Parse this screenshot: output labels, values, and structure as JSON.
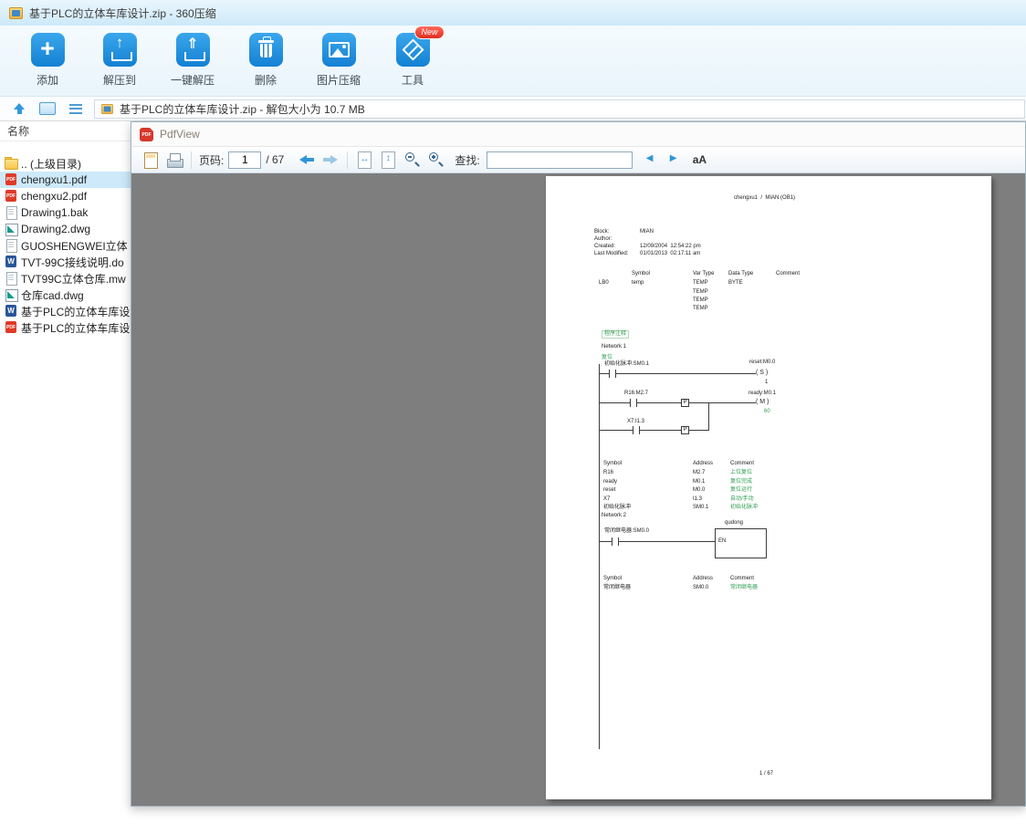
{
  "window": {
    "title": "基于PLC的立体车库设计.zip - 360压缩"
  },
  "toolbar": {
    "items": [
      {
        "label": "添加",
        "icon": "add-icon"
      },
      {
        "label": "解压到",
        "icon": "extract-to-icon"
      },
      {
        "label": "一键解压",
        "icon": "one-click-extract-icon"
      },
      {
        "label": "删除",
        "icon": "delete-icon"
      },
      {
        "label": "图片压缩",
        "icon": "image-compress-icon"
      },
      {
        "label": "工具",
        "icon": "tools-icon",
        "badge": "New"
      }
    ]
  },
  "addressbar": {
    "path": "基于PLC的立体车库设计.zip - 解包大小为 10.7 MB"
  },
  "filelist": {
    "header": "名称",
    "items": [
      {
        "name": ".. (上级目录)",
        "type": "folder"
      },
      {
        "name": "chengxu1.pdf",
        "type": "pdf",
        "selected": true
      },
      {
        "name": "chengxu2.pdf",
        "type": "pdf"
      },
      {
        "name": "Drawing1.bak",
        "type": "bak"
      },
      {
        "name": "Drawing2.dwg",
        "type": "dwg"
      },
      {
        "name": "GUOSHENGWEI立体",
        "type": "file"
      },
      {
        "name": "TVT-99C接线说明.do",
        "type": "doc"
      },
      {
        "name": "TVT99C立体仓库.mw",
        "type": "mwp"
      },
      {
        "name": "仓库cad.dwg",
        "type": "dwg"
      },
      {
        "name": "基于PLC的立体车库设",
        "type": "doc"
      },
      {
        "name": "基于PLC的立体车库设",
        "type": "pdf"
      }
    ]
  },
  "pdfviewer": {
    "title": "PdfView",
    "toolbar": {
      "page_label": "页码:",
      "page_value": "1",
      "page_total": "/ 67",
      "find_label": "查找:",
      "find_value": "",
      "font_button": "aA"
    }
  },
  "pdf_page": {
    "header": "chengxu1  /  MIAN (OB1)",
    "block_info": [
      {
        "label": "Block:",
        "value": "MIAN"
      },
      {
        "label": "Author:",
        "value": ""
      },
      {
        "label": "Created:",
        "value": "12/09/2004  12:54:22 pm"
      },
      {
        "label": "Last Modified:",
        "value": "01/01/2013  02:17:11 am"
      }
    ],
    "var_table": {
      "headers": [
        "Symbol",
        "Var Type",
        "Data Type",
        "Comment"
      ],
      "rows": [
        {
          "addr": "LB0",
          "symbol": "temp",
          "var_type": "TEMP",
          "data_type": "BYTE"
        },
        {
          "addr": "",
          "symbol": "",
          "var_type": "TEMP",
          "data_type": ""
        },
        {
          "addr": "",
          "symbol": "",
          "var_type": "TEMP",
          "data_type": ""
        },
        {
          "addr": "",
          "symbol": "",
          "var_type": "TEMP",
          "data_type": ""
        }
      ]
    },
    "program_comment": "程序注释",
    "network1": {
      "label": "Network 1",
      "title": "复位",
      "contact1": "初始化脉冲:SM0.1",
      "coil1_label": "reset:M0.0",
      "coil1": "( S )",
      "coil1_count": "1",
      "contact2": "R16:M2.7",
      "coil2_label": "ready:M0.1",
      "coil2": "( M )",
      "coil2_count": "60",
      "contact3": "X7:I1.3",
      "p_label": "P"
    },
    "symbol_table1": {
      "headers": [
        "Symbol",
        "Address",
        "Comment"
      ],
      "rows": [
        [
          "R16",
          "M2.7",
          "上位复位"
        ],
        [
          "ready",
          "M0.1",
          "复位完成"
        ],
        [
          "reset",
          "M0.0",
          "复位运行"
        ],
        [
          "X7",
          "I1.3",
          "自动/手动"
        ],
        [
          "初始化脉冲",
          "SM0.1",
          "初始化脉冲"
        ]
      ]
    },
    "network2": {
      "label": "Network 2",
      "contact": "常闭继电器:SM0.0",
      "box_title": "qudong",
      "box_port": "EN"
    },
    "symbol_table2": {
      "headers": [
        "Symbol",
        "Address",
        "Comment"
      ],
      "rows": [
        [
          "常闭继电器",
          "SM0.0",
          "常闭继电器"
        ]
      ]
    },
    "footer": "1 / 67"
  }
}
